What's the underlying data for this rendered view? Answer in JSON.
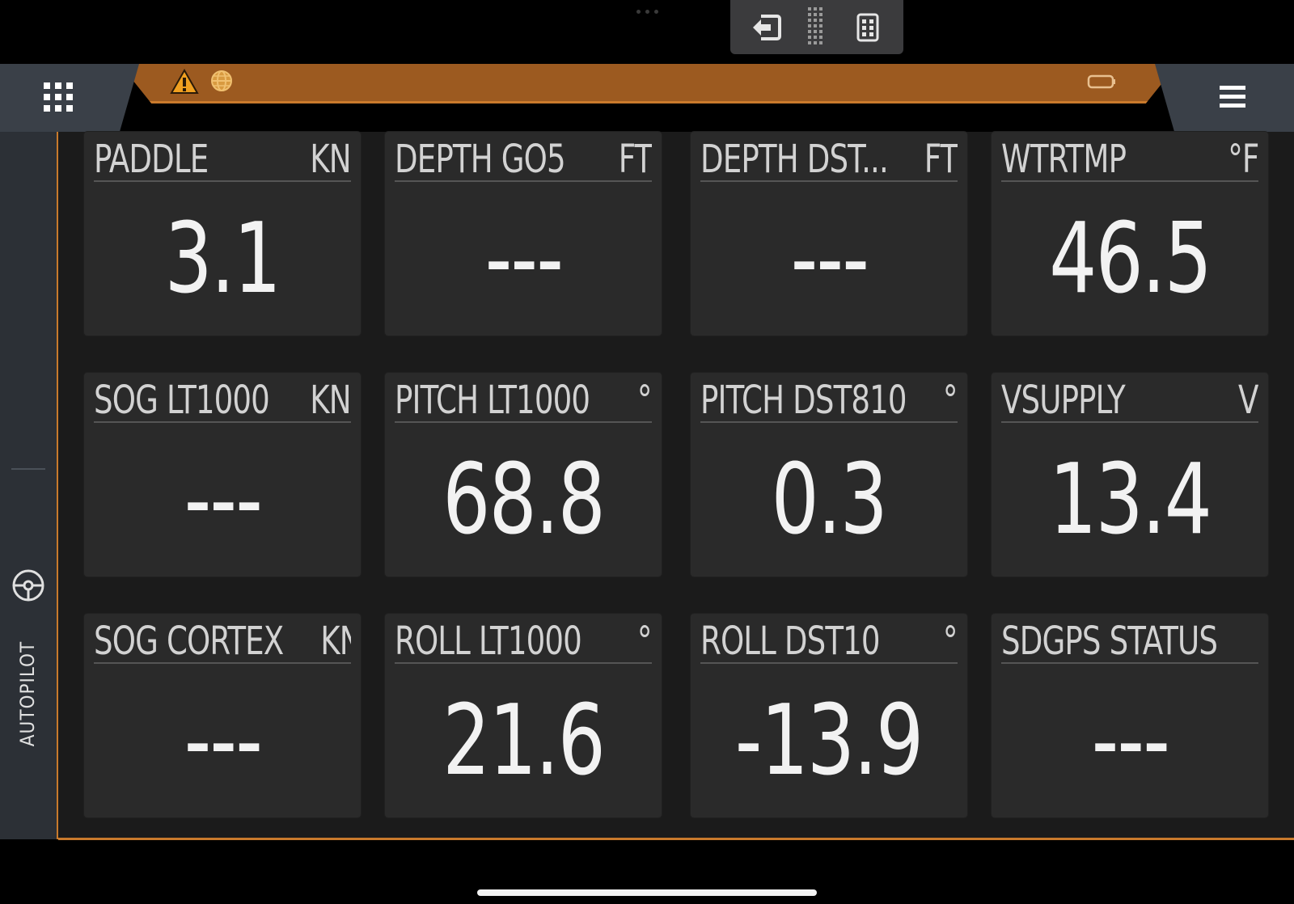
{
  "toolbar": {
    "buttons": [
      {
        "name": "exit-icon"
      },
      {
        "name": "drag-handle-icon"
      },
      {
        "name": "calculator-icon"
      }
    ]
  },
  "header": {
    "accent_color": "#9c5a20",
    "status_icons": [
      "warning-icon",
      "globe-icon",
      "battery-icon"
    ]
  },
  "side_panel": {
    "autopilot_label": "AUTOPILOT"
  },
  "tiles": [
    {
      "title": "PADDLE",
      "unit": "KN",
      "value": "3.1"
    },
    {
      "title": "DEPTH GO5",
      "unit": "FT",
      "value": "---"
    },
    {
      "title": "DEPTH DST...",
      "unit": "FT",
      "value": "---"
    },
    {
      "title": "WTRTMP",
      "unit": "°F",
      "value": "46.5"
    },
    {
      "title": "SOG LT1000",
      "unit": "KN",
      "value": "---"
    },
    {
      "title": "PITCH LT1000",
      "unit": "°",
      "value": "68.8"
    },
    {
      "title": "PITCH DST810",
      "unit": "°",
      "value": "0.3"
    },
    {
      "title": "VSUPPLY",
      "unit": "V",
      "value": "13.4"
    },
    {
      "title": "SOG CORTEX",
      "unit": "KN",
      "value": "---"
    },
    {
      "title": "ROLL LT1000",
      "unit": "°",
      "value": "21.6"
    },
    {
      "title": "ROLL DST10",
      "unit": "°",
      "value": "-13.9"
    },
    {
      "title": "SDGPS STATUS",
      "unit": "",
      "value": "---"
    }
  ]
}
